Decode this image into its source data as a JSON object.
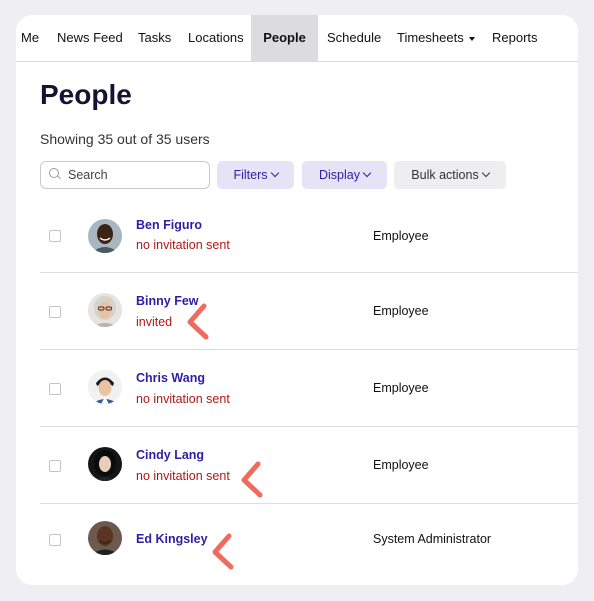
{
  "nav": {
    "items": [
      {
        "label": "Me"
      },
      {
        "label": "News Feed"
      },
      {
        "label": "Tasks"
      },
      {
        "label": "Locations"
      },
      {
        "label": "People"
      },
      {
        "label": "Schedule"
      },
      {
        "label": "Timesheets"
      },
      {
        "label": "Reports"
      }
    ],
    "active": "People"
  },
  "page": {
    "title": "People",
    "showing": "Showing 35 out of 35 users"
  },
  "toolbar": {
    "search_placeholder": "Search",
    "filters_label": "Filters",
    "display_label": "Display",
    "bulk_label": "Bulk actions"
  },
  "users": [
    {
      "name": "Ben Figuro",
      "status": "no invitation sent",
      "role": "Employee"
    },
    {
      "name": "Binny Few",
      "status": "invited",
      "role": "Employee"
    },
    {
      "name": "Chris Wang",
      "status": "no invitation sent",
      "role": "Employee"
    },
    {
      "name": "Cindy Lang",
      "status": "no invitation sent",
      "role": "Employee"
    },
    {
      "name": "Ed Kingsley",
      "status": "",
      "role": "System Administrator"
    }
  ],
  "colors": {
    "accent": "#2d1fa5",
    "status_red": "#b01818",
    "annotation": "#f06a5e",
    "active_tab_bg": "#dcdce0"
  }
}
